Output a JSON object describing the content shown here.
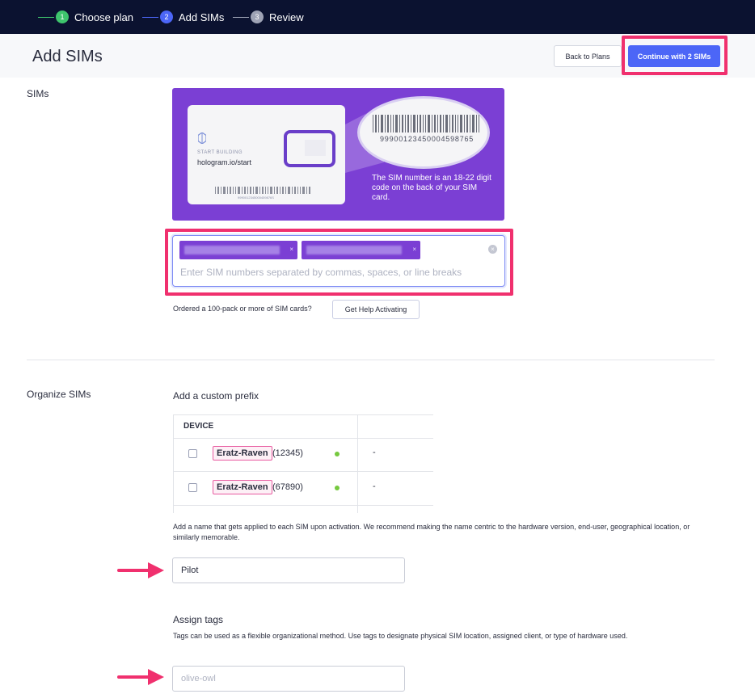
{
  "stepper": {
    "steps": [
      {
        "number": "1",
        "label": "Choose plan",
        "state": "complete",
        "color": "#3ec46d"
      },
      {
        "number": "2",
        "label": "Add SIMs",
        "state": "current",
        "color": "#4c66f7"
      },
      {
        "number": "3",
        "label": "Review",
        "state": "upcoming",
        "color": "#9ea3b5"
      }
    ]
  },
  "header": {
    "title": "Add SIMs",
    "back_label": "Back to Plans",
    "continue_label": "Continue with 2 SIMs"
  },
  "sims": {
    "section_label": "SIMs",
    "card": {
      "start_text": "START BUILDING",
      "url": "hologram.io/start",
      "small_barcode_number": "9990012345000459876S",
      "large_barcode_number": "99900123450004598765",
      "caption": "The SIM number is an 18-22 digit code on the back of your SIM card."
    },
    "input": {
      "chips": [
        {
          "remove": "×"
        },
        {
          "remove": "×"
        }
      ],
      "placeholder": "Enter SIM numbers separated by commas, spaces, or line breaks"
    },
    "help_text": "Ordered a 100-pack or more of SIM cards?",
    "help_button": "Get Help Activating"
  },
  "organize": {
    "section_label": "Organize SIMs",
    "prefix_heading": "Add a custom prefix",
    "table": {
      "header": "DEVICE",
      "rows": [
        {
          "name": "Eratz-Raven",
          "id": "(12345)",
          "value": "-"
        },
        {
          "name": "Eratz-Raven",
          "id": "(67890)",
          "value": "-"
        }
      ]
    },
    "prefix_description": "Add a name that gets applied to each SIM upon activation. We recommend making the name centric to the hardware version, end-user, geographical location, or similarly memorable.",
    "prefix_value": "Pilot",
    "tags_heading": "Assign tags",
    "tags_description": "Tags can be used as a flexible organizational method. Use tags to designate physical SIM location, assigned client, or type of hardware used.",
    "tags_placeholder": "olive-owl"
  },
  "colors": {
    "navbar": "#0b1230",
    "accent": "#4c66f7",
    "highlight": "#f0306e",
    "sim_purple": "#7b3fd4"
  }
}
